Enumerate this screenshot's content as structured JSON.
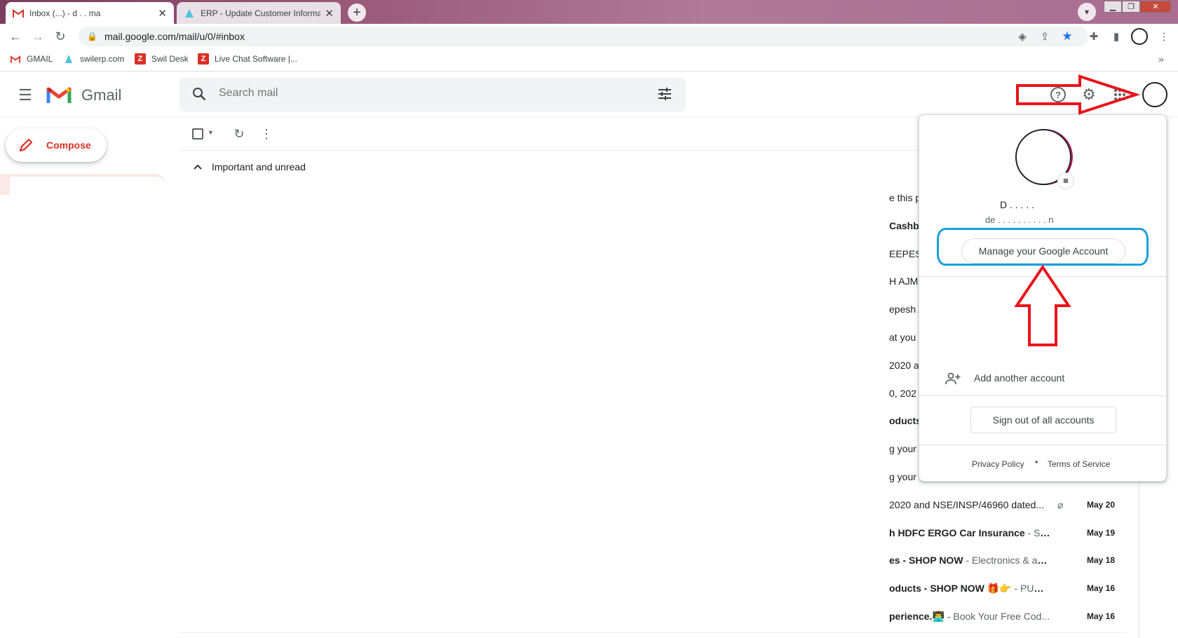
{
  "browser": {
    "tabs": [
      {
        "title": "Inbox (...) - d  .  . ma",
        "active": true
      },
      {
        "title": "ERP - Update Customer Informat",
        "active": false
      }
    ],
    "new_tab_glyph": "+",
    "close_glyph": "✕",
    "url": "mail.google.com/mail/u/0/#inbox",
    "bookmarks": [
      {
        "label": "GMAIL",
        "icon": "gmail-icon"
      },
      {
        "label": "swilerp.com",
        "icon": "swilerp-icon"
      },
      {
        "label": "Swil Desk",
        "icon": "z-icon"
      },
      {
        "label": "Live Chat Software |...",
        "icon": "z-icon"
      }
    ],
    "bookmarks_more": "»"
  },
  "gmail": {
    "wordmark": "Gmail",
    "search_placeholder": "Search mail",
    "compose_label": "Compose",
    "section_title": "Important and unread",
    "mail_rows": [
      {
        "subject": "e this p",
        "snippet": "",
        "date": "",
        "bold": false
      },
      {
        "subject": "Cashba",
        "snippet": "",
        "date": "",
        "bold": true
      },
      {
        "subject": "EEPES",
        "snippet": "",
        "date": "",
        "bold": false
      },
      {
        "subject": "H AJM",
        "snippet": "",
        "date": "",
        "bold": false
      },
      {
        "subject": "epesh A",
        "snippet": "",
        "date": "",
        "bold": false
      },
      {
        "subject": "at you",
        "snippet": "",
        "date": "",
        "bold": false
      },
      {
        "subject": "2020 a",
        "snippet": "",
        "date": "",
        "bold": false
      },
      {
        "subject": "0, 202",
        "snippet": "",
        "date": "",
        "bold": false
      },
      {
        "subject": "oducts",
        "snippet": "",
        "date": "",
        "bold": true
      },
      {
        "subject": "g your",
        "snippet": "",
        "date": "",
        "bold": false
      },
      {
        "subject": "g your",
        "snippet": "",
        "date": "",
        "bold": false
      },
      {
        "subject": "2020 and NSE/INSP/46960 dated...",
        "snippet": "",
        "date": "May 20",
        "bold": false,
        "attachment": true
      },
      {
        "subject": "h HDFC ERGO Car Insurance",
        "snippet": " - Sav...",
        "date": "May 19",
        "bold": true
      },
      {
        "subject": "es - SHOP NOW",
        "snippet": " - Electronics & acc...",
        "date": "May 18",
        "bold": true
      },
      {
        "subject": "oducts - SHOP NOW 🎁👉",
        "snippet": " - PUMA...",
        "date": "May 16",
        "bold": true
      },
      {
        "subject": "perience.👨‍💻",
        "snippet": " - Book Your Free Cod...",
        "date": "May 16",
        "bold": true
      }
    ]
  },
  "account_popup": {
    "name": "D . . . . .",
    "email": "de . . . . . . . . . . n",
    "manage_label": "Manage your Google Account",
    "add_account_label": "Add another account",
    "sign_out_label": "Sign out of all accounts",
    "privacy_label": "Privacy Policy",
    "separator": "•",
    "terms_label": "Terms of Service"
  },
  "colors": {
    "gmail_red": "#d93025",
    "annotation_red": "#e8141c",
    "annotation_blue": "#1a9fe0"
  }
}
